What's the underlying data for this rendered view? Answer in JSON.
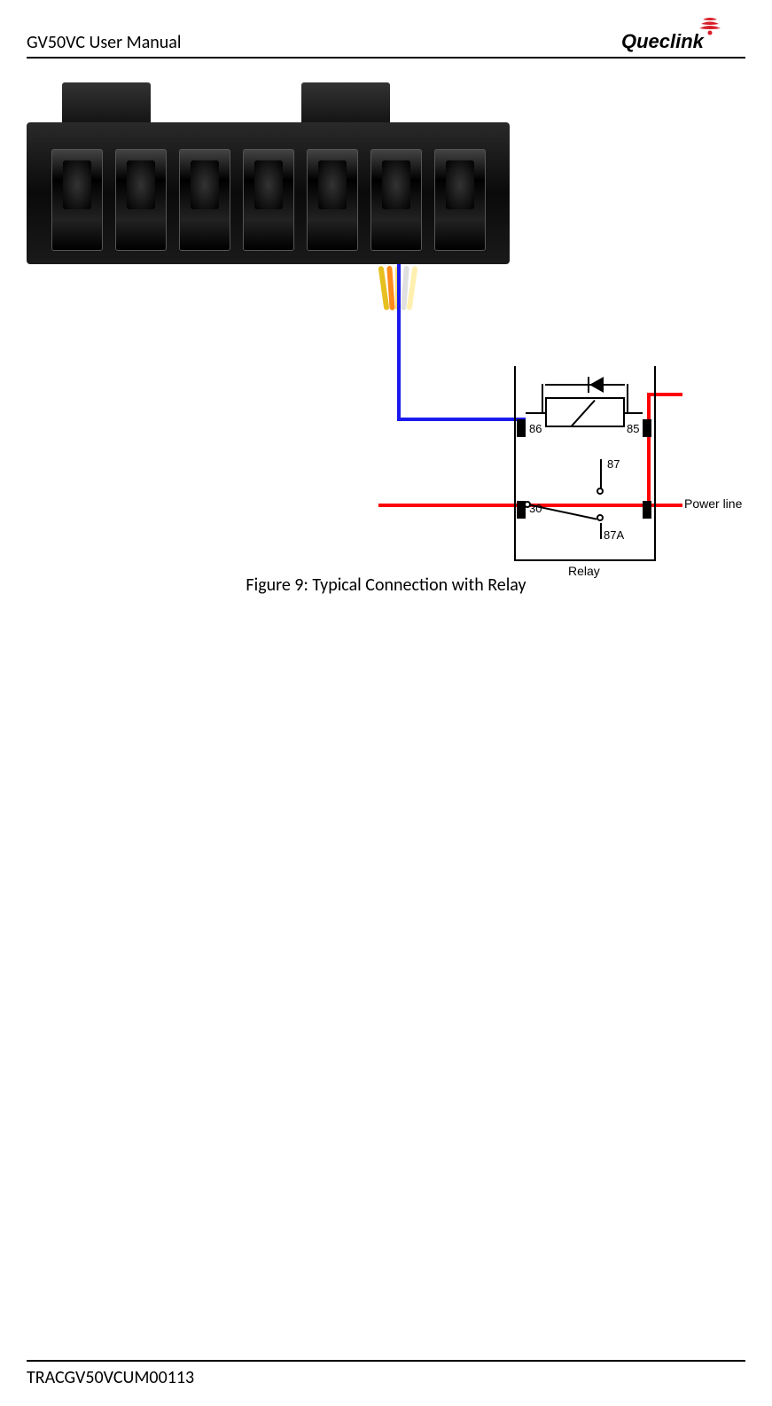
{
  "header": {
    "title": "GV50VC User Manual",
    "brand": "Queclink"
  },
  "figure": {
    "caption": "Figure 9: Typical Connection with Relay",
    "relay": {
      "label": "Relay",
      "terminals": {
        "t86": "86",
        "t85": "85",
        "t30": "30",
        "t87": "87",
        "t87a": "87A"
      },
      "power_line_label": "Power line"
    }
  },
  "footer": {
    "doc_id": "TRACGV50VCUM00113"
  }
}
